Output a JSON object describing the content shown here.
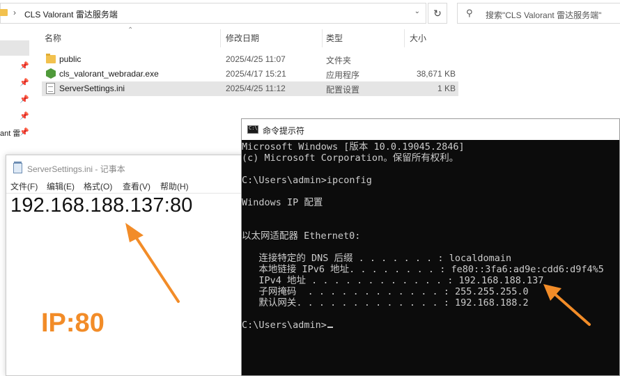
{
  "explorer": {
    "address_path": "CLS Valorant 雷达服务端",
    "search_placeholder": "搜索\"CLS Valorant 雷达服务端\"",
    "nav_partial_label": "ant 雷",
    "columns": {
      "name": "名称",
      "modified": "修改日期",
      "type": "类型",
      "size": "大小"
    },
    "files": [
      {
        "name": "public",
        "modified": "2025/4/25 11:07",
        "type": "文件夹",
        "size": "",
        "icon": "folder-icon"
      },
      {
        "name": "cls_valorant_webradar.exe",
        "modified": "2025/4/17 15:21",
        "type": "应用程序",
        "size": "38,671 KB",
        "icon": "exe-icon"
      },
      {
        "name": "ServerSettings.ini",
        "modified": "2025/4/25 11:12",
        "type": "配置设置",
        "size": "1 KB",
        "icon": "ini-file-icon"
      }
    ]
  },
  "notepad": {
    "title": "ServerSettings.ini - 记事本",
    "menu": [
      "文件(F)",
      "编辑(E)",
      "格式(O)",
      "查看(V)",
      "帮助(H)"
    ],
    "content": "192.168.188.137:80",
    "annotation": "IP:80",
    "annotation_color": "#f28c28"
  },
  "cmd": {
    "title": "命令提示符",
    "lines": [
      "Microsoft Windows [版本 10.0.19045.2846]",
      "(c) Microsoft Corporation。保留所有权利。",
      "",
      "C:\\Users\\admin>ipconfig",
      "",
      "Windows IP 配置",
      "",
      "",
      "以太网适配器 Ethernet0:",
      "",
      "   连接特定的 DNS 后缀 . . . . . . . : localdomain",
      "   本地链接 IPv6 地址. . . . . . . . : fe80::3fa6:ad9e:cdd6:d9f4%5",
      "   IPv4 地址 . . . . . . . . . . . . : 192.168.188.137",
      "   子网掩码  . . . . . . . . . . . . : 255.255.255.0",
      "   默认网关. . . . . . . . . . . . . : 192.168.188.2",
      "",
      "C:\\Users\\admin>"
    ]
  },
  "colors": {
    "accent_arrow": "#f28c28",
    "cmd_bg": "#0c0c0c",
    "cmd_fg": "#cccccc",
    "selection": "#e5e5e5"
  }
}
